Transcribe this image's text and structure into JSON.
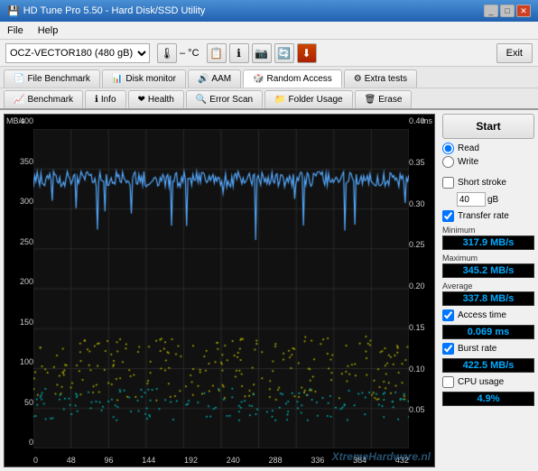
{
  "window": {
    "title": "HD Tune Pro 5.50 - Hard Disk/SSD Utility",
    "icon": "💾"
  },
  "menu": {
    "items": [
      "File",
      "Help"
    ]
  },
  "toolbar": {
    "drive": "OCZ-VECTOR180 (480 gB)",
    "temperature": "– °C",
    "exit_label": "Exit"
  },
  "tabs_row1": [
    {
      "id": "file-benchmark",
      "label": "File Benchmark",
      "icon": "📄"
    },
    {
      "id": "disk-monitor",
      "label": "Disk monitor",
      "icon": "📊"
    },
    {
      "id": "aam",
      "label": "AAM",
      "icon": "🔊"
    },
    {
      "id": "random-access",
      "label": "Random Access",
      "icon": "🎲",
      "active": true
    },
    {
      "id": "extra-tests",
      "label": "Extra tests",
      "icon": "⚙"
    }
  ],
  "tabs_row2": [
    {
      "id": "benchmark",
      "label": "Benchmark",
      "icon": "📈"
    },
    {
      "id": "info",
      "label": "Info",
      "icon": "ℹ"
    },
    {
      "id": "health",
      "label": "Health",
      "icon": "❤"
    },
    {
      "id": "error-scan",
      "label": "Error Scan",
      "icon": "🔍"
    },
    {
      "id": "folder-usage",
      "label": "Folder Usage",
      "icon": "📁"
    },
    {
      "id": "erase",
      "label": "Erase",
      "icon": "🗑"
    }
  ],
  "chart": {
    "unit_left": "MB/s",
    "unit_right": "ms",
    "y_labels_left": [
      "400",
      "350",
      "300",
      "250",
      "200",
      "150",
      "100",
      "50",
      "0"
    ],
    "y_labels_right": [
      "0.40",
      "0.35",
      "0.30",
      "0.25",
      "0.20",
      "0.15",
      "0.10",
      "0.05",
      ""
    ],
    "x_labels": [
      "0",
      "48",
      "96",
      "144",
      "192",
      "240",
      "288",
      "336",
      "384",
      "432"
    ]
  },
  "controls": {
    "start_label": "Start",
    "read_label": "Read",
    "write_label": "Write",
    "short_stroke_label": "Short stroke",
    "stroke_value": "40",
    "stroke_unit": "gB",
    "transfer_rate_label": "Transfer rate",
    "access_time_label": "Access time",
    "burst_rate_label": "Burst rate",
    "cpu_usage_label": "CPU usage"
  },
  "stats": {
    "minimum_label": "Minimum",
    "minimum_value": "317.9 MB/s",
    "maximum_label": "Maximum",
    "maximum_value": "345.2 MB/s",
    "average_label": "Average",
    "average_value": "337.8 MB/s",
    "access_time_value": "0.069 ms",
    "burst_rate_value": "422.5 MB/s",
    "cpu_usage_value": "4.9%"
  },
  "watermark": "XtremeHardwar..."
}
